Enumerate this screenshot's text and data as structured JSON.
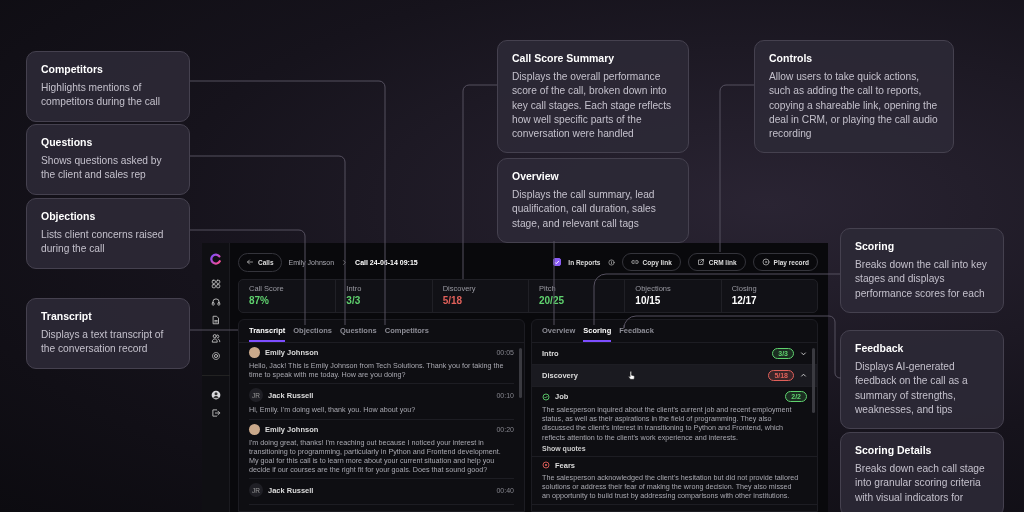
{
  "left_callouts": [
    {
      "title": "Competitors",
      "text": "Highlights mentions of competitors during the call"
    },
    {
      "title": "Questions",
      "text": "Shows questions asked by the client and sales rep"
    },
    {
      "title": "Objections",
      "text": "Lists client concerns raised during the call"
    },
    {
      "title": "Transcript",
      "text": "Displays a text transcript of the conversation record"
    }
  ],
  "top_callouts": [
    {
      "title": "Call Score Summary",
      "text": "Displays the overall performance score of the call, broken down into key call stages. Each stage reflects how well specific parts of the conversation were handled"
    },
    {
      "title": "Overview",
      "text": "Displays the call summary, lead qualification, call duration, sales stage, and relevant call tags"
    },
    {
      "title": "Controls",
      "text": "Allow users to take quick actions, such as adding the call to reports, copying a shareable link, opening the deal in CRM, or playing the call audio recording"
    }
  ],
  "right_callouts": [
    {
      "title": "Scoring",
      "text": "Breaks down the call into key stages and displays performance scores for each"
    },
    {
      "title": "Feedback",
      "text": "Displays AI-generated feedback on the call as a summary of strengths, weaknesses, and tips"
    },
    {
      "title": "Scoring Details",
      "text": "Breaks down each call stage into granular scoring criteria with visual indicators for"
    }
  ],
  "app": {
    "header": {
      "back_button": "Calls",
      "breadcrumb": [
        "Emily Johnson",
        "Call 24-06-14 09:15"
      ],
      "in_reports": {
        "label": "In Reports",
        "checked": true
      },
      "buttons": [
        {
          "label": "Copy link"
        },
        {
          "label": "CRM link"
        },
        {
          "label": "Play record"
        }
      ]
    },
    "scores": [
      {
        "label": "Call Score",
        "value": "87%",
        "color": "#5fd16e"
      },
      {
        "label": "Intro",
        "value": "3/3",
        "color": "#5fd16e"
      },
      {
        "label": "Discovery",
        "value": "5/18",
        "color": "#e0605a"
      },
      {
        "label": "Pitch",
        "value": "20/25",
        "color": "#5fd16e"
      },
      {
        "label": "Objections",
        "value": "10/15",
        "color": "#ffffff"
      },
      {
        "label": "Closing",
        "value": "12/17",
        "color": "#ffffff"
      }
    ],
    "transcript_tabs": [
      {
        "label": "Transcript",
        "selected": true
      },
      {
        "label": "Objections",
        "selected": false
      },
      {
        "label": "Questions",
        "selected": false
      },
      {
        "label": "Competitors",
        "selected": false
      }
    ],
    "messages": [
      {
        "speaker": "Emily Johnson",
        "kind": "photo",
        "time": "00:05",
        "text": "Hello, Jack! This is Emily Johnson from Tech Solutions. Thank you for taking the time to speak with me today. How are you doing?"
      },
      {
        "speaker": "Jack Russell",
        "kind": "initials",
        "initials": "JR",
        "time": "00:10",
        "text": "Hi, Emily. I'm doing well, thank you. How about you?"
      },
      {
        "speaker": "Emily Johnson",
        "kind": "photo",
        "time": "00:20",
        "text": "I'm doing great, thanks! I'm reaching out because I noticed your interest in transitioning to programming, particularly in Python and Frontend development. My goal for this call is to learn more about your current situation and help you decide if our courses are the right fit for your goals. Does that sound good?"
      },
      {
        "speaker": "Jack Russell",
        "kind": "initials",
        "initials": "JR",
        "time": "00:40"
      }
    ],
    "scoring_tabs": [
      {
        "label": "Overview",
        "selected": false
      },
      {
        "label": "Scoring",
        "selected": true
      },
      {
        "label": "Feedback",
        "selected": false
      }
    ],
    "stages": [
      {
        "name": "Intro",
        "score": "3/3",
        "color": "#5fd16e",
        "expanded": false
      },
      {
        "name": "Discovery",
        "score": "5/18",
        "color": "#e0605a",
        "expanded": true,
        "criteria": [
          {
            "name": "Job",
            "passed": true,
            "score": "2/2",
            "text": "The salesperson inquired about the client's current job and recent employment status, as well as their aspirations in the field of programming. They also discussed the client's interest in transitioning to Python and Frontend, which reflects attention to the client's work experience and interests.",
            "link": "Show quotes"
          },
          {
            "name": "Fears",
            "passed": false,
            "text": "The salesperson acknowledged the client's hesitation but did not provide tailored solutions or address their fear of making the wrong decision. They also missed an opportunity to build trust by addressing comparisons with other institutions."
          }
        ]
      }
    ]
  }
}
